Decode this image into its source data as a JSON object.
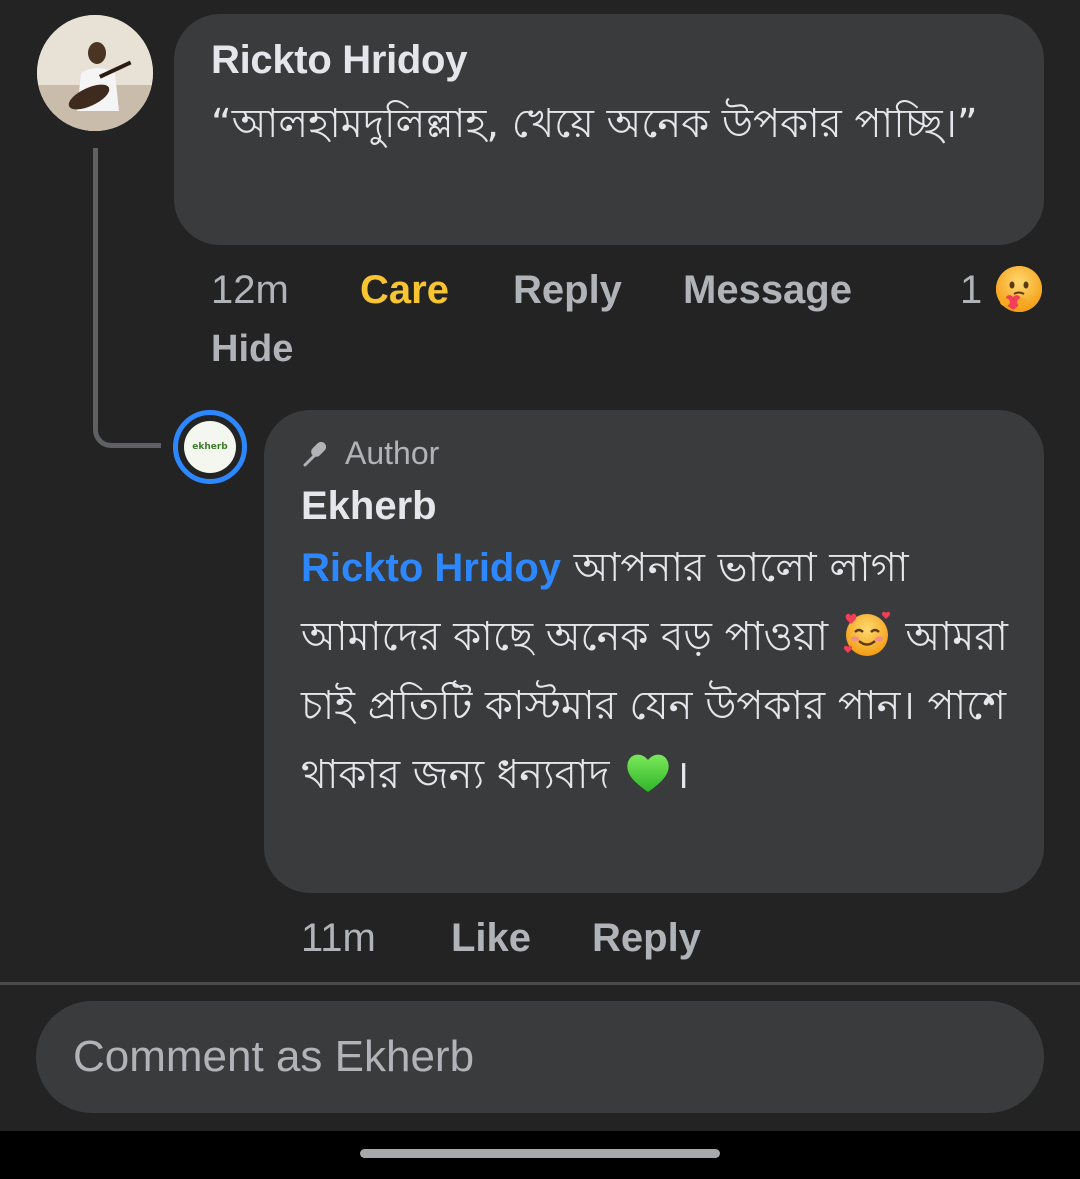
{
  "comment": {
    "author": "Rickto Hridoy",
    "text": "“আলহামদুলিল্লাহ, খেয়ে অনেক উপকার পাচ্ছি।”",
    "time": "12m",
    "reaction_label": "Care",
    "reply_label": "Reply",
    "message_label": "Message",
    "reaction_count": "1",
    "hide_label": "Hide",
    "reaction_emoji": "care-emoji",
    "reaction_color": "#f7c531"
  },
  "reply": {
    "badge": "Author",
    "author": "Ekherb",
    "mention": "Rickto Hridoy",
    "text_part1": " আপনার ভালো লাগা আমাদের কাছে অনেক বড় পাওয়া ",
    "emoji1": "smiling-face-with-hearts-emoji",
    "text_part2": " আমরা চাই প্রতিটি কাস্টমার যেন উপকার পান। পাশে থাকার জন্য ধন্যবাদ ",
    "emoji2": "green-heart-emoji",
    "text_part3": "।",
    "time": "11m",
    "like_label": "Like",
    "reply_label": "Reply",
    "mention_color": "#2d88ff",
    "avatar_logo": "ekherb"
  },
  "composer": {
    "placeholder": "Comment as Ekherb"
  }
}
